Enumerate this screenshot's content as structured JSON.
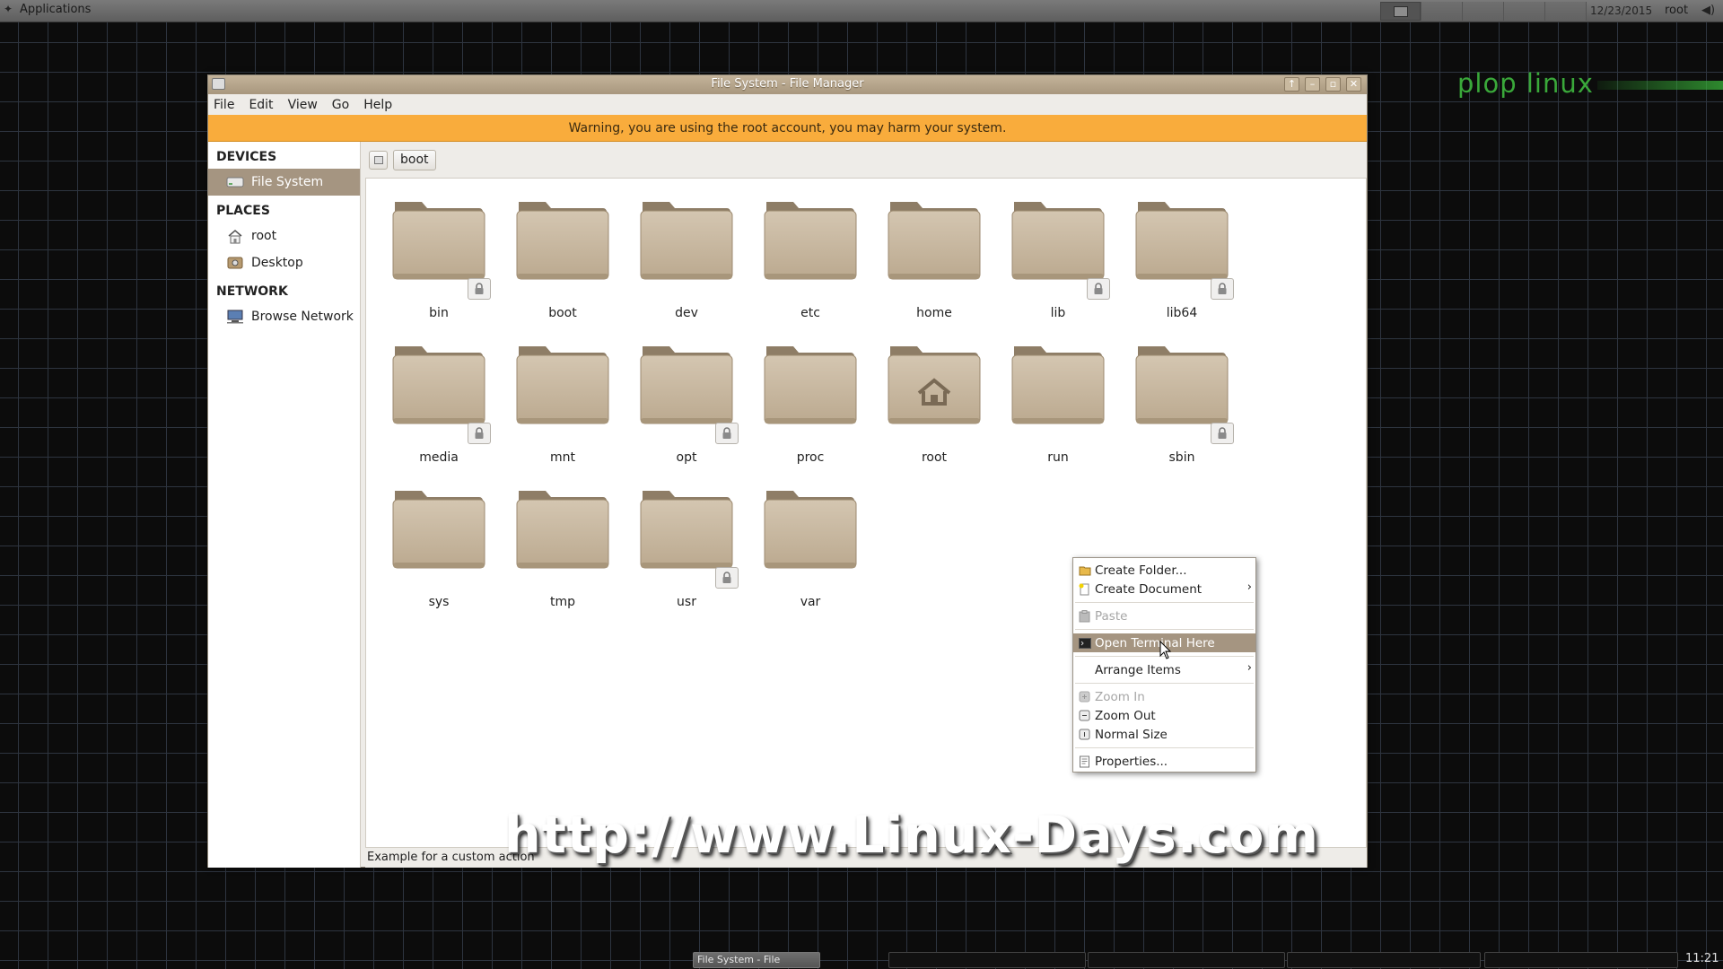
{
  "top_panel": {
    "applications_label": "Applications",
    "date": "12/23/2015",
    "user": "root"
  },
  "brand": "plop linux",
  "window": {
    "title": "File System - File Manager",
    "menu": [
      "File",
      "Edit",
      "View",
      "Go",
      "Help"
    ],
    "warning": "Warning, you are using the root account, you may harm your system."
  },
  "sidebar": {
    "devices_heading": "DEVICES",
    "devices": [
      {
        "label": "File System",
        "icon": "drive-icon",
        "selected": true
      }
    ],
    "places_heading": "PLACES",
    "places": [
      {
        "label": "root",
        "icon": "home-icon"
      },
      {
        "label": "Desktop",
        "icon": "desktop-icon"
      }
    ],
    "network_heading": "NETWORK",
    "network": [
      {
        "label": "Browse Network",
        "icon": "network-icon"
      }
    ]
  },
  "location": {
    "crumb": "boot"
  },
  "files": [
    {
      "name": "bin",
      "locked": true
    },
    {
      "name": "boot",
      "locked": false
    },
    {
      "name": "dev",
      "locked": false
    },
    {
      "name": "etc",
      "locked": false
    },
    {
      "name": "home",
      "locked": false
    },
    {
      "name": "lib",
      "locked": true
    },
    {
      "name": "lib64",
      "locked": true
    },
    {
      "name": "media",
      "locked": true
    },
    {
      "name": "mnt",
      "locked": false
    },
    {
      "name": "opt",
      "locked": true
    },
    {
      "name": "proc",
      "locked": false
    },
    {
      "name": "root",
      "locked": false,
      "home": true
    },
    {
      "name": "run",
      "locked": false
    },
    {
      "name": "sbin",
      "locked": true
    },
    {
      "name": "sys",
      "locked": false
    },
    {
      "name": "tmp",
      "locked": false
    },
    {
      "name": "usr",
      "locked": true
    },
    {
      "name": "var",
      "locked": false
    }
  ],
  "status_text": "Example for a custom action",
  "context_menu": {
    "items": [
      {
        "label": "Create Folder...",
        "icon": "folder-new-icon"
      },
      {
        "label": "Create Document",
        "icon": "document-new-icon",
        "submenu": true
      },
      {
        "label": "Paste",
        "icon": "paste-icon",
        "disabled": true
      },
      {
        "label": "Open Terminal Here",
        "icon": "terminal-icon",
        "highlighted": true
      },
      {
        "label": "Arrange Items",
        "submenu": true
      },
      {
        "label": "Zoom In",
        "icon": "zoom-in-icon",
        "disabled": true
      },
      {
        "label": "Zoom Out",
        "icon": "zoom-out-icon"
      },
      {
        "label": "Normal Size",
        "icon": "zoom-normal-icon"
      },
      {
        "label": "Properties...",
        "icon": "properties-icon"
      }
    ]
  },
  "watermark": "http://www.Linux-Days.com",
  "bottom_panel": {
    "task_label": "File System - File Mana...",
    "clock": "11:21"
  },
  "colors": {
    "accent": "#a59581",
    "warning": "#f9ac3c",
    "brand": "#3aa83a",
    "folder": "#cbbba3"
  }
}
